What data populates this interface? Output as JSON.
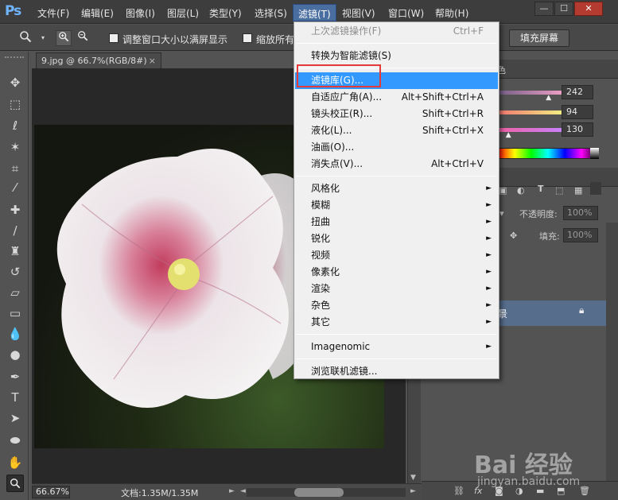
{
  "app": {
    "logo": "Ps"
  },
  "menu": {
    "items": [
      "文件(F)",
      "编辑(E)",
      "图像(I)",
      "图层(L)",
      "类型(Y)",
      "选择(S)",
      "滤镜(T)",
      "视图(V)",
      "窗口(W)",
      "帮助(H)"
    ],
    "active_index": 6
  },
  "window_controls": {
    "minimize": "—",
    "restore": "☐",
    "close": "✕"
  },
  "options_bar": {
    "tool_icon": "zoom-icon",
    "resize_windows_label": "调整窗口大小以满屏显示",
    "zoom_all_label": "缩放所有",
    "fill_screen_label": "填充屏幕"
  },
  "document": {
    "tab_title": "9.jpg @ 66.7%(RGB/8#)",
    "tab_close": "×"
  },
  "status_bar": {
    "zoom": "66.67%",
    "doc_info": "文档:1.35M/1.35M"
  },
  "color_panel": {
    "tab_label": "色",
    "values": [
      "242",
      "94",
      "130"
    ],
    "slider_knobs": [
      0.78,
      0.05,
      0.22
    ],
    "slider_colors": [
      [
        "#6b5a82",
        "#f2a0c8"
      ],
      [
        "#f26e6e",
        "#f2f282"
      ],
      [
        "#f25e9e",
        "#c882ff"
      ]
    ]
  },
  "layers_panel": {
    "opacity_label": "不透明度:",
    "opacity_value": "100%",
    "fill_label": "填充:",
    "fill_value": "100%",
    "layer_name_fragment": "景"
  },
  "filter_menu": {
    "items": [
      {
        "label": "上次滤镜操作(F)",
        "shortcut": "Ctrl+F",
        "disabled": true
      },
      {
        "sep": true
      },
      {
        "label": "转换为智能滤镜(S)"
      },
      {
        "sep": true
      },
      {
        "label": "滤镜库(G)...",
        "highlighted": true
      },
      {
        "label": "自适应广角(A)...",
        "shortcut": "Alt+Shift+Ctrl+A"
      },
      {
        "label": "镜头校正(R)...",
        "shortcut": "Shift+Ctrl+R"
      },
      {
        "label": "液化(L)...",
        "shortcut": "Shift+Ctrl+X"
      },
      {
        "label": "油画(O)..."
      },
      {
        "label": "消失点(V)...",
        "shortcut": "Alt+Ctrl+V"
      },
      {
        "sep": true
      },
      {
        "label": "风格化",
        "submenu": true
      },
      {
        "label": "模糊",
        "submenu": true
      },
      {
        "label": "扭曲",
        "submenu": true
      },
      {
        "label": "锐化",
        "submenu": true
      },
      {
        "label": "视频",
        "submenu": true
      },
      {
        "label": "像素化",
        "submenu": true
      },
      {
        "label": "渲染",
        "submenu": true
      },
      {
        "label": "杂色",
        "submenu": true
      },
      {
        "label": "其它",
        "submenu": true
      },
      {
        "sep": true
      },
      {
        "label": "Imagenomic",
        "submenu": true
      },
      {
        "sep": true
      },
      {
        "label": "浏览联机滤镜..."
      }
    ]
  },
  "watermark": {
    "main": "Bai 经验",
    "sub": "jingyan.baidu.com"
  }
}
